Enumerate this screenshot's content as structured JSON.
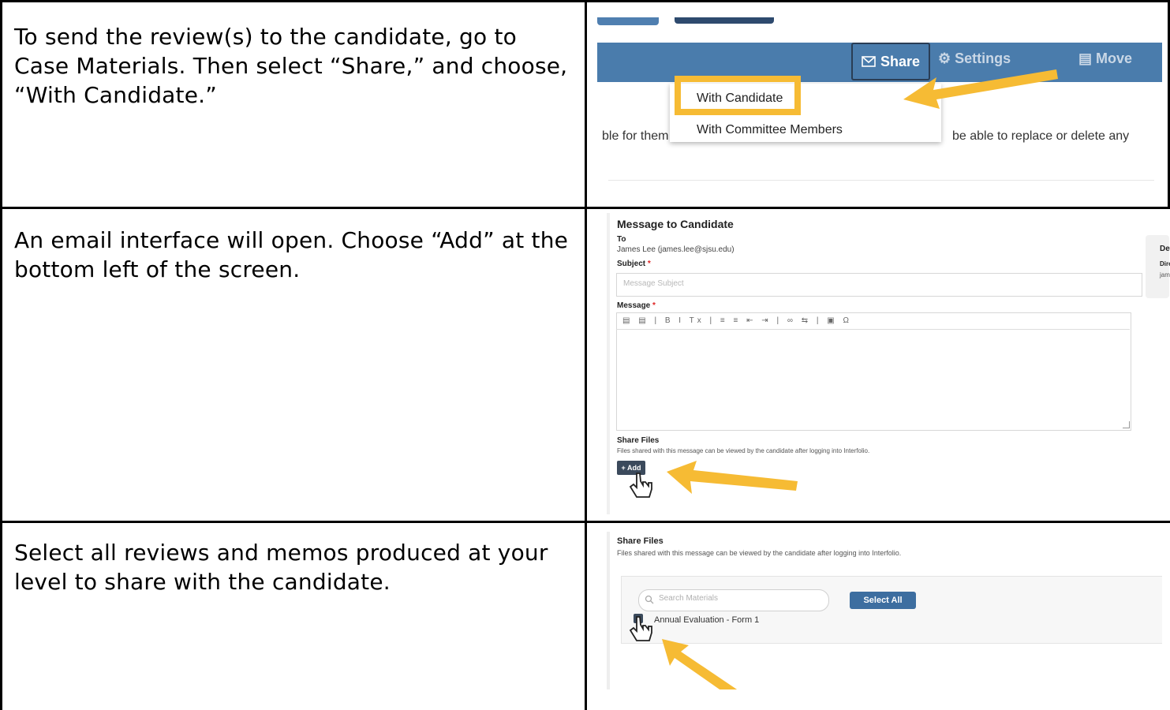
{
  "steps": [
    {
      "text": "To send the review(s) to the candidate, go to Case Materials. Then select “Share,” and choose, “With Candidate.”"
    },
    {
      "text": "An email interface will open. Choose “Add” at the bottom left of the screen."
    },
    {
      "text": "Select all reviews and memos produced at your level to share with the candidate."
    }
  ],
  "screenshot1": {
    "share_label": "Share",
    "settings_label": "Settings",
    "move_label": "Move",
    "menu_items": [
      "With Candidate",
      "With Committee Members"
    ],
    "bg_text_left": "ble for them t",
    "bg_text_right": "be able to replace or delete any",
    "share_icon": "envelope-icon",
    "settings_icon": "gears-icon",
    "move_icon": "move-icon"
  },
  "screenshot2": {
    "title": "Message to Candidate",
    "to_label": "To",
    "to_value": "James Lee (james.lee@sjsu.edu)",
    "subject_label": "Subject",
    "subject_placeholder": "Message Subject",
    "message_label": "Message",
    "required_marker": "*",
    "toolbar_glyphs": "▤ ▤ | B I Tx | ≡ ≡ ⇤ ⇥ | ∞ ⇆ | ▣ Ω",
    "share_files_label": "Share Files",
    "share_files_desc": "Files shared with this message can be viewed by the candidate after logging into Interfolio.",
    "add_button": "+ Add",
    "side_panel_lines": [
      "Deta",
      "Direc",
      "jame"
    ]
  },
  "screenshot3": {
    "share_files_label": "Share Files",
    "share_files_desc": "Files shared with this message can be viewed by the candidate after logging into Interfolio.",
    "search_placeholder": "Search Materials",
    "select_all": "Select All",
    "item_label": "Annual Evaluation - Form 1"
  },
  "colors": {
    "arrow": "#f6bb34",
    "bar": "#4a7cac",
    "border": "#000000"
  }
}
